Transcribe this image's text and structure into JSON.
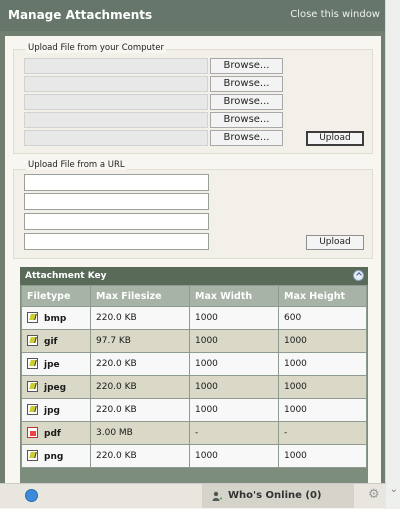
{
  "window": {
    "title": "Manage Attachments",
    "close_label": "Close this window"
  },
  "upload_computer": {
    "legend": "Upload File from your Computer",
    "browse_label": "Browse...",
    "upload_label": "Upload"
  },
  "upload_url": {
    "legend": "Upload File from a URL",
    "upload_label": "Upload"
  },
  "attachment_key": {
    "title": "Attachment Key",
    "columns": [
      "Filetype",
      "Max Filesize",
      "Max Width",
      "Max Height"
    ],
    "rows": [
      {
        "type": "bmp",
        "size": "220.0 KB",
        "width": "1000",
        "height": "600",
        "icon": "image-file-icon"
      },
      {
        "type": "gif",
        "size": "97.7 KB",
        "width": "1000",
        "height": "1000",
        "icon": "image-file-icon"
      },
      {
        "type": "jpe",
        "size": "220.0 KB",
        "width": "1000",
        "height": "1000",
        "icon": "image-file-icon"
      },
      {
        "type": "jpeg",
        "size": "220.0 KB",
        "width": "1000",
        "height": "1000",
        "icon": "image-file-icon"
      },
      {
        "type": "jpg",
        "size": "220.0 KB",
        "width": "1000",
        "height": "1000",
        "icon": "image-file-icon"
      },
      {
        "type": "pdf",
        "size": "3.00 MB",
        "width": "-",
        "height": "-",
        "icon": "pdf-file-icon"
      },
      {
        "type": "png",
        "size": "220.0 KB",
        "width": "1000",
        "height": "1000",
        "icon": "image-file-icon"
      }
    ]
  },
  "footer": {
    "whos_online": "Who's Online (0)"
  }
}
